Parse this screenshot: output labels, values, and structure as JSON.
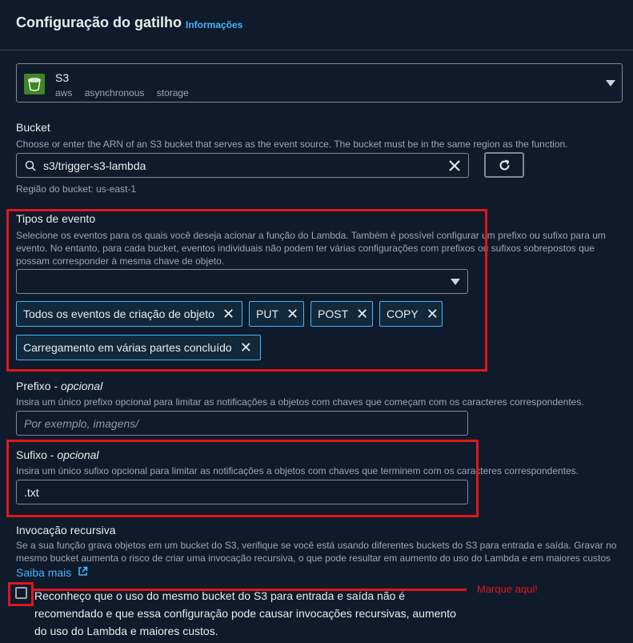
{
  "header": {
    "title": "Configuração do gatilho",
    "info_link": "Informações"
  },
  "source": {
    "name": "S3",
    "tags": [
      "aws",
      "asynchronous",
      "storage"
    ]
  },
  "bucket": {
    "label": "Bucket",
    "description": "Choose or enter the ARN of an S3 bucket that serves as the event source. The bucket must be in the same region as the function.",
    "value": "s3/trigger-s3-lambda",
    "region_text": "Região do bucket: us-east-1"
  },
  "event_types": {
    "label": "Tipos de evento",
    "description_lines": [
      "Selecione os eventos para os quais você deseja acionar a função do Lambda. Também é possível configurar um prefixo ou sufixo para um",
      "evento. No entanto, para cada bucket, eventos individuais não podem ter várias configurações com prefixos ou sufixos sobrepostos que",
      "possam corresponder à mesma chave de objeto."
    ],
    "tokens": [
      "Todos os eventos de criação de objeto",
      "PUT",
      "POST",
      "COPY",
      "Carregamento em várias partes concluído"
    ]
  },
  "prefix": {
    "label": "Prefixo",
    "optional": "opcional",
    "description": "Insira um único prefixo opcional para limitar as notificações a objetos com chaves que começam com os caracteres correspondentes.",
    "placeholder": "Por exemplo, imagens/"
  },
  "suffix": {
    "label": "Sufixo",
    "optional": "opcional",
    "description": "Insira um único sufixo opcional para limitar as notificações a objetos com chaves que terminem com os caracteres correspondentes.",
    "value": ".txt"
  },
  "recursive": {
    "label": "Invocação recursiva",
    "description_lines": [
      "Se a sua função grava objetos em um bucket do S3, verifique se você está usando diferentes buckets do S3 para entrada e saída. Gravar no",
      "mesmo bucket aumenta o risco de criar uma invocação recursiva, o que pode resultar em aumento do uso do Lambda e em maiores custos"
    ],
    "learn_more": "Saiba mais",
    "ack_lines": [
      "Reconheço que o uso do mesmo bucket do S3 para entrada e saída não é",
      "recomendado e que essa configuração pode causar invocações recursivas, aumento",
      "do uso do Lambda e maiores custos."
    ],
    "ack_checked": false
  },
  "annotation": {
    "text": "Marque aqui!",
    "color": "#e0161e"
  },
  "colors": {
    "background": "#0f1b2a",
    "link": "#42b4ff",
    "token_border": "#42b4ff",
    "s3_green": "#3f8624"
  }
}
